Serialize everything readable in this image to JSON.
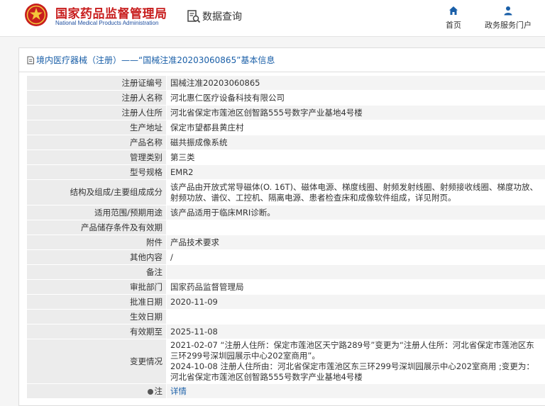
{
  "header": {
    "org_cn": "国家药品监督管理局",
    "org_en": "National Medical Products Administration",
    "query_label": "数据查询",
    "nav": {
      "home": "首页",
      "service": "政务服务门户"
    },
    "brand_color": "#c81e1e",
    "accent_color": "#1a5fa8"
  },
  "breadcrumb": "境内医疗器械（注册）——“国械注准20203060865”基本信息",
  "rows": [
    {
      "label": "注册证编号",
      "value": "国械注准20203060865"
    },
    {
      "label": "注册人名称",
      "value": "河北惠仁医疗设备科技有限公司"
    },
    {
      "label": "注册人住所",
      "value": "河北省保定市莲池区创智路555号数字产业基地4号楼"
    },
    {
      "label": "生产地址",
      "value": "保定市望都县黄庄村"
    },
    {
      "label": "产品名称",
      "value": "磁共振成像系统"
    },
    {
      "label": "管理类别",
      "value": "第三类"
    },
    {
      "label": "型号规格",
      "value": "EMR2"
    },
    {
      "label": "结构及组成/主要组成成分",
      "value": "该产品由开放式常导磁体(O. 16T)、磁体电源、梯度线圈、射频发射线圈、射频接收线圈、梯度功放、射频功放、谱仪、工控机、隔离电源、患者检查床和成像软件组成，详见附页。"
    },
    {
      "label": "适用范围/预期用途",
      "value": "该产品适用于临床MRI诊断。"
    },
    {
      "label": "产品储存条件及有效期",
      "value": ""
    },
    {
      "label": "附件",
      "value": "产品技术要求"
    },
    {
      "label": "其他内容",
      "value": "/"
    },
    {
      "label": "备注",
      "value": ""
    },
    {
      "label": "审批部门",
      "value": "国家药品监督管理局"
    },
    {
      "label": "批准日期",
      "value": "2020-11-09"
    },
    {
      "label": "生效日期",
      "value": ""
    },
    {
      "label": "有效期至",
      "value": "2025-11-08"
    },
    {
      "label": "变更情况",
      "value_lines": [
        "2021-02-07 “注册人住所：保定市莲池区天宁路289号”变更为“注册人住所：河北省保定市莲池区东三环299号深圳园展示中心202室商用”。",
        "2024-10-08 注册人住所由：河北省保定市莲池区东三环299号深圳园展示中心202室商用 ;变更为：河北省保定市莲池区创智路555号数字产业基地4号楼"
      ]
    },
    {
      "label": "注",
      "value": "详情",
      "is_link": true
    }
  ]
}
